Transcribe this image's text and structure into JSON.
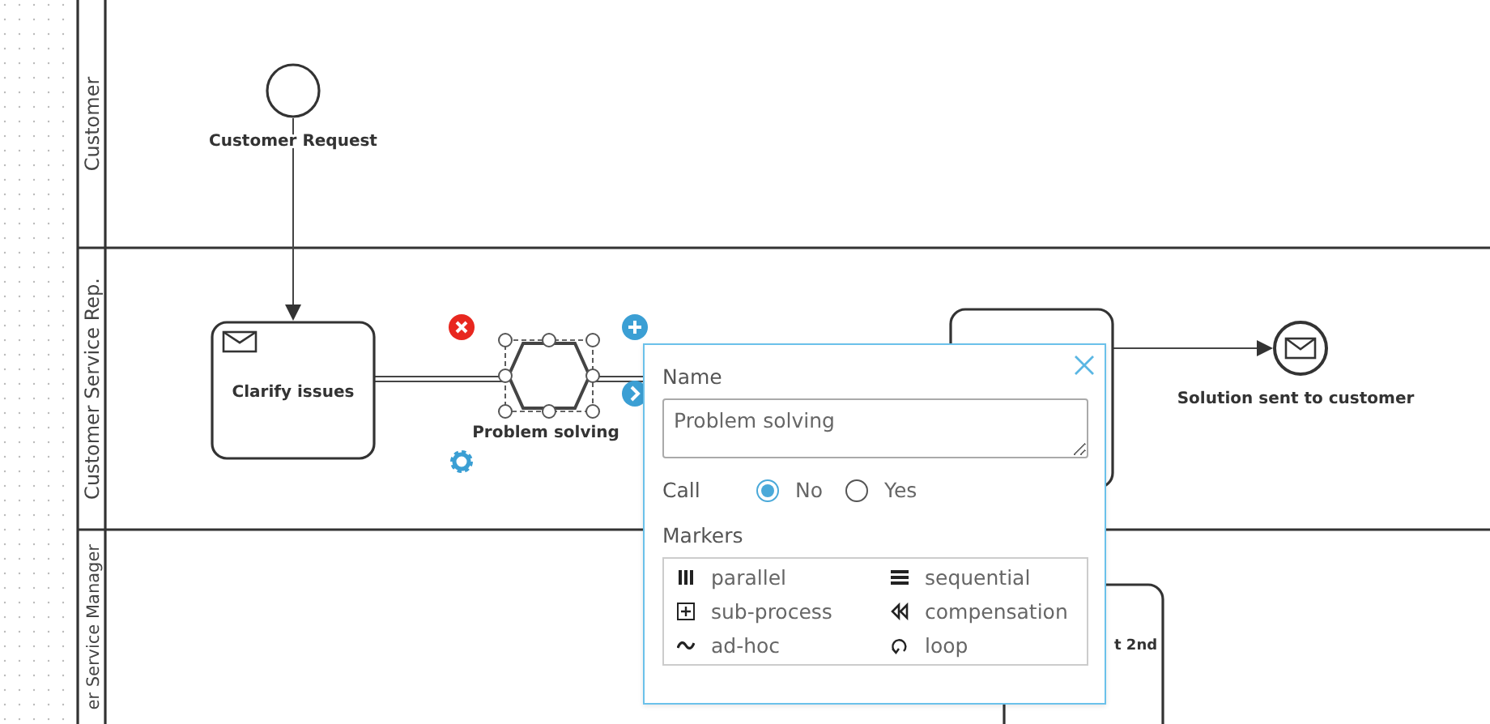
{
  "lanes": [
    {
      "label": "Customer"
    },
    {
      "label": "Customer Service Rep."
    },
    {
      "label": "er Service Manager"
    }
  ],
  "nodes": [
    {
      "kind": "start_event",
      "label": "Customer Request",
      "selected": false
    },
    {
      "kind": "message_task",
      "label": "Clarify issues",
      "selected": false
    },
    {
      "kind": "hexagon_task",
      "label": "Problem solving",
      "selected": true
    },
    {
      "kind": "task",
      "selected": false
    },
    {
      "kind": "message_end_event",
      "label": "Solution sent to customer",
      "selected": false
    },
    {
      "kind": "task",
      "label": "t 2nd",
      "selected": false
    }
  ],
  "properties_popup": {
    "name_label": "Name",
    "name_value": "Problem solving",
    "call": {
      "label": "Call",
      "options": [
        {
          "label": "No",
          "selected": true
        },
        {
          "label": "Yes",
          "selected": false
        }
      ]
    },
    "markers": {
      "label": "Markers",
      "items": [
        {
          "kind": "parallel",
          "label": "parallel"
        },
        {
          "kind": "sequential",
          "label": "sequential"
        },
        {
          "kind": "sub_process",
          "label": "sub-process"
        },
        {
          "kind": "compensation",
          "label": "compensation"
        },
        {
          "kind": "ad_hoc",
          "label": "ad-hoc"
        },
        {
          "kind": "loop",
          "label": "loop"
        }
      ]
    }
  }
}
